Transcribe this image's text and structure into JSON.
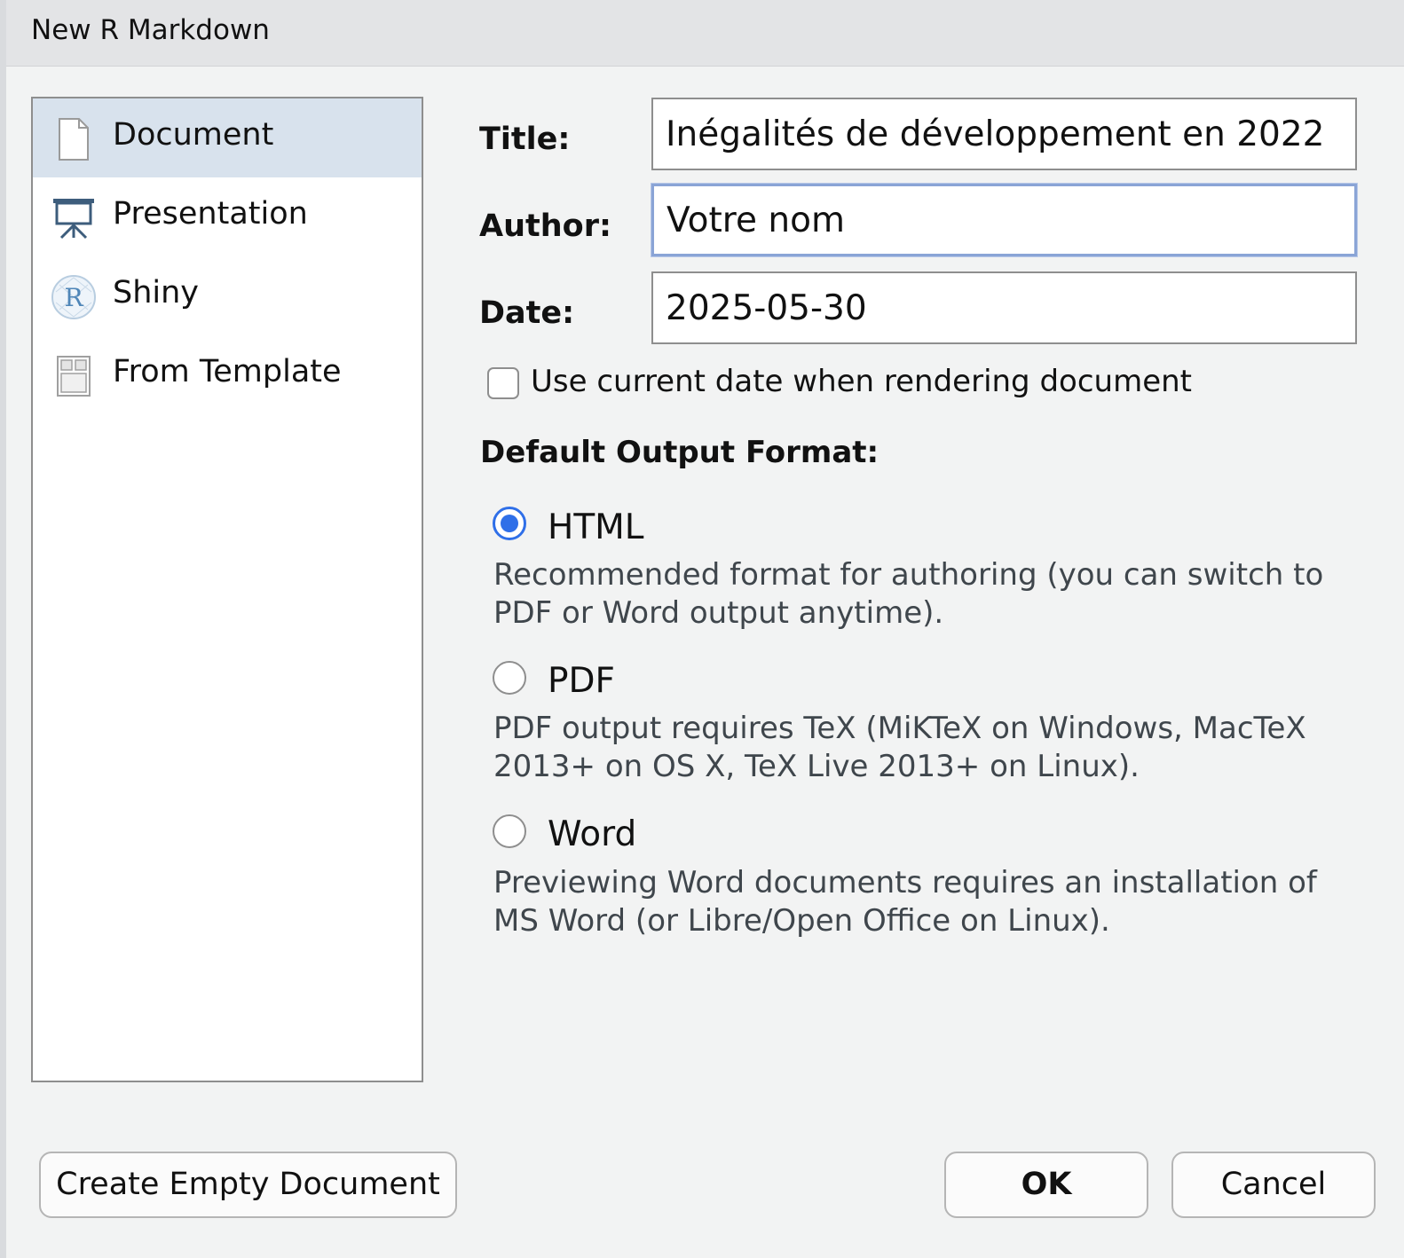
{
  "window": {
    "title": "New R Markdown"
  },
  "types": [
    {
      "label": "Document",
      "icon": "document-icon",
      "selected": true
    },
    {
      "label": "Presentation",
      "icon": "presentation-easel-icon",
      "selected": false
    },
    {
      "label": "Shiny",
      "icon": "shiny-r-icon",
      "selected": false
    },
    {
      "label": "From Template",
      "icon": "template-icon",
      "selected": false
    }
  ],
  "form": {
    "title_label": "Title:",
    "title_value": "Inégalités de développement en 2022",
    "author_label": "Author:",
    "author_value": "Votre nom",
    "date_label": "Date:",
    "date_value": "2025-05-30",
    "use_current_date_label": "Use current date when rendering document",
    "use_current_date_checked": false
  },
  "output": {
    "heading": "Default Output Format:",
    "options": [
      {
        "label": "HTML",
        "checked": true,
        "desc_line1": "Recommended format for authoring (you can switch to",
        "desc_line2": "PDF or Word output anytime)."
      },
      {
        "label": "PDF",
        "checked": false,
        "desc_line1": "PDF output requires TeX (MiKTeX on Windows, MacTeX",
        "desc_line2": "2013+ on OS X, TeX Live 2013+ on Linux)."
      },
      {
        "label": "Word",
        "checked": false,
        "desc_line1": "Previewing Word documents requires an installation of",
        "desc_line2": "MS Word (or Libre/Open Office on Linux)."
      }
    ]
  },
  "buttons": {
    "create_empty": "Create Empty Document",
    "ok": "OK",
    "cancel": "Cancel"
  },
  "colors": {
    "selection": "#d8e2ed",
    "radio_accent": "#2f6fe8",
    "focus_ring": "#8aa4d6"
  }
}
